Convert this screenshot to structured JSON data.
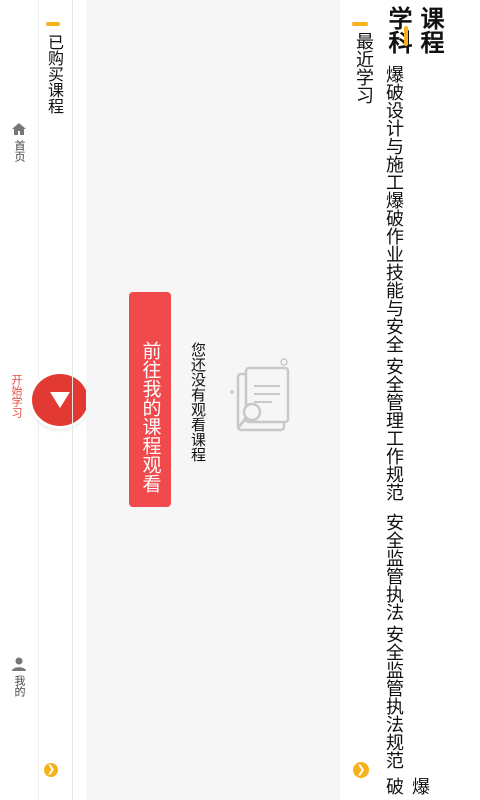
{
  "header": {
    "title": "课程",
    "subject_label": "学科"
  },
  "tabs": [
    "爆破设计与施工",
    "爆破作业技能与安全",
    "安全管理工作规范",
    "安全监管执法",
    "安全监管执法规范",
    "爆破"
  ],
  "recent": {
    "title": "最近学习"
  },
  "empty_state": {
    "message": "您还没有观看课程",
    "button_label": "前往我的课程观看"
  },
  "section": {
    "title": "已购买课程"
  },
  "bottom_nav": {
    "home_label": "首页",
    "start_label": "开始学习",
    "mine_label": "我的"
  },
  "colors": {
    "accent": "#f7b21b",
    "primary": "#f04a4d",
    "start_button": "#e23a32"
  }
}
